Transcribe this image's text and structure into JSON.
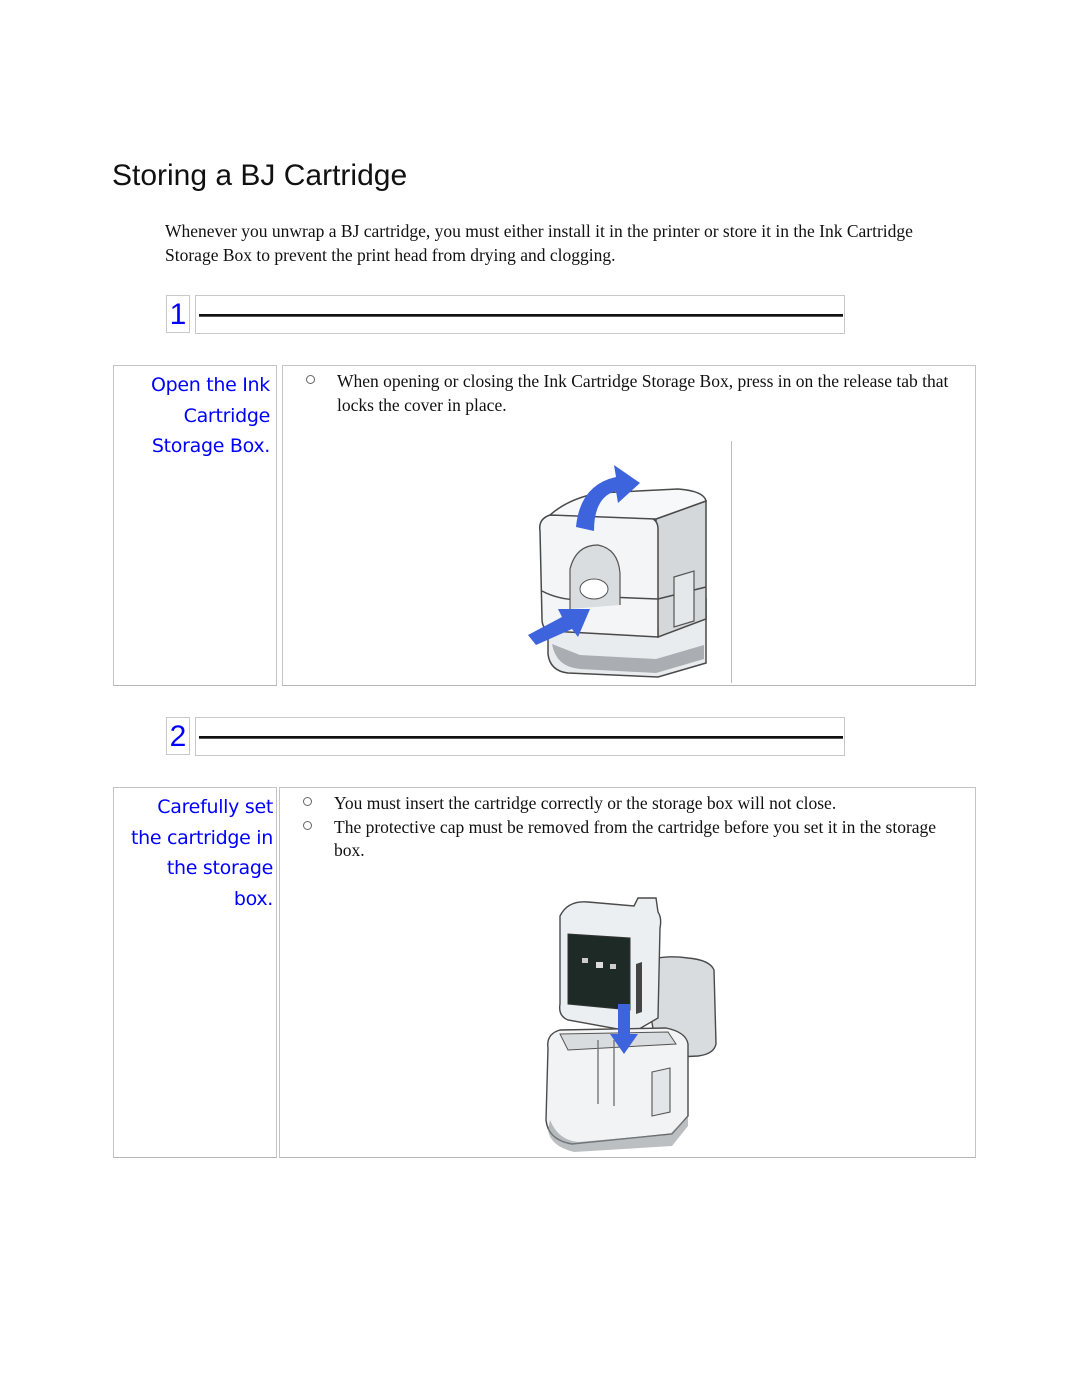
{
  "page": {
    "title": "Storing a BJ Cartridge",
    "intro": "Whenever you unwrap a BJ cartridge, you must either install it in the printer or store it in the Ink Cartridge Storage Box to prevent the print head from drying and clogging."
  },
  "colors": {
    "step_text": "#0000ff",
    "arrow": "#3d63dd",
    "border": "#c4c4c4"
  },
  "steps": [
    {
      "number": "1",
      "label_lines": [
        "Open the Ink",
        "Cartridge",
        "Storage Box."
      ],
      "bullets": [
        "When opening or closing the Ink Cartridge Storage Box, press in on the release tab that locks the cover in place."
      ],
      "illustration": "storage-box-open-illustration",
      "bullet_icon": "circle-bullet-icon"
    },
    {
      "number": "2",
      "label_lines": [
        "Carefully set",
        "the cartridge in",
        "the storage",
        "box."
      ],
      "bullets": [
        "You must insert the cartridge correctly or the storage box will not close.",
        "The protective cap must be removed from the cartridge before you set it in the storage box."
      ],
      "illustration": "cartridge-insert-illustration",
      "bullet_icon": "circle-bullet-icon"
    }
  ]
}
